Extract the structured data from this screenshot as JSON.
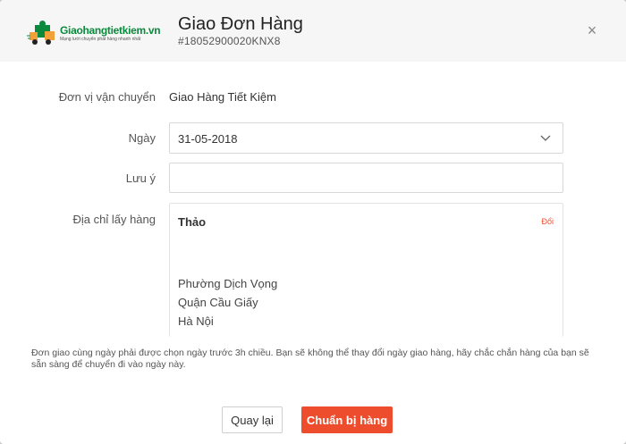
{
  "header": {
    "logo_name": "Giaohangtietkiem.vn",
    "logo_tagline": "Mạng lưới chuyển phát hàng nhanh nhất",
    "title": "Giao Đơn Hàng",
    "order_code": "#18052900020KNX8",
    "close_label": "×"
  },
  "form": {
    "carrier_label": "Đơn vị vận chuyển",
    "carrier_value": "Giao Hàng Tiết Kiệm",
    "date_label": "Ngày",
    "date_value": "31-05-2018",
    "note_label": "Lưu ý",
    "note_value": "",
    "address_label": "Địa chỉ lấy hàng",
    "address": {
      "name": "Thảo",
      "change_label": "Đổi",
      "ward": "Phường Dịch Vọng",
      "district": "Quận Cầu Giấy",
      "city": "Hà Nội"
    }
  },
  "info_note": "Đơn giao cùng ngày phải được chọn ngày trước 3h chiều. Bạn sẽ không thể thay đổi ngày giao hàng, hãy chắc chắn hàng của bạn sẽ sẵn sàng để chuyển đi vào ngày này.",
  "footer": {
    "back_label": "Quay lại",
    "confirm_label": "Chuẩn bị hàng"
  },
  "colors": {
    "accent": "#ee4d2d",
    "logo_green": "#0b8a3e"
  },
  "icons": {
    "logo": "delivery-truck-icon",
    "close": "close-icon",
    "date_dropdown": "chevron-down-icon"
  }
}
